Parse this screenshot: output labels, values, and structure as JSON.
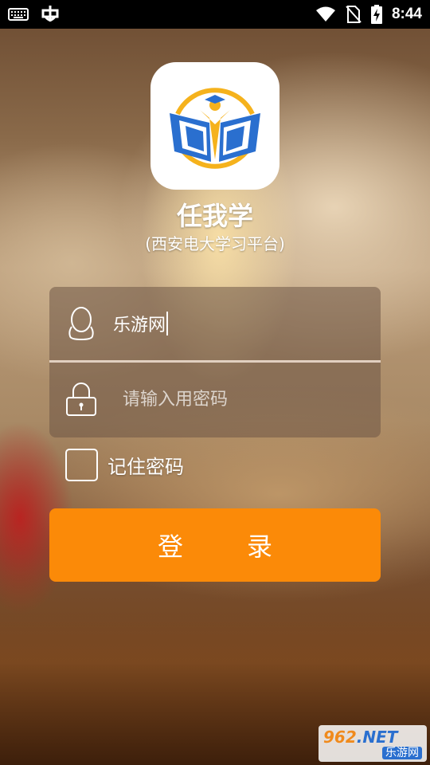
{
  "status_bar": {
    "time": "8:44",
    "icons": [
      "keyboard-icon",
      "bug-icon",
      "wifi-icon",
      "no-sim-icon",
      "battery-charging-icon"
    ]
  },
  "app": {
    "name": "任我学",
    "subtitle": "(西安电大学习平台)",
    "logo_icon": "open-book-graduate-logo"
  },
  "login_form": {
    "username_value": "乐游网",
    "password_placeholder": "请输入用密码",
    "remember_label": "记住密码",
    "remember_checked": false,
    "login_button": "登录"
  },
  "watermark": {
    "brand": "962",
    "suffix": ".NET",
    "site_name": "乐游网"
  },
  "colors": {
    "accent": "#fb8a08",
    "logo_blue": "#2a6fcf",
    "logo_yellow": "#f5b21c"
  }
}
